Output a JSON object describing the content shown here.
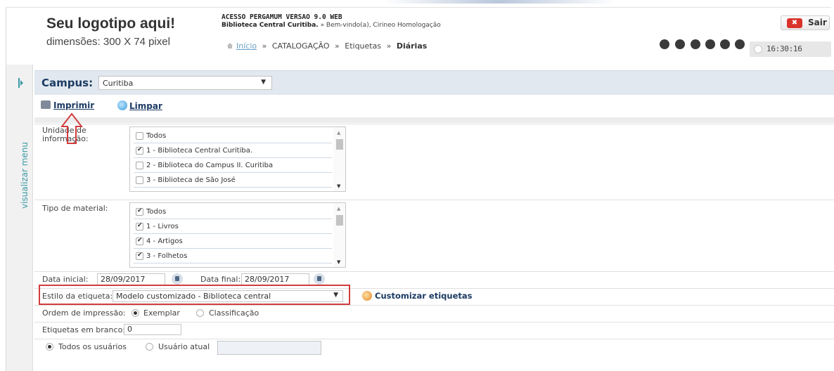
{
  "header": {
    "logo_title": "Seu logotipo aqui!",
    "logo_sub": "dimensões: 300 X 74 pixel",
    "app_title": "ACESSO PERGAMUM VERSAO 9.0 WEB",
    "library": "Biblioteca Central Curitiba.",
    "welcome": " » Bem-vindo(a), Cirineo Homologação",
    "logout_label": "Sair",
    "time": "16:30:16"
  },
  "breadcrumb": {
    "home": "Início",
    "items": [
      "CATALOGAÇÃO",
      "Etiquetas"
    ],
    "current": "Diárias",
    "separator": "»"
  },
  "toolbar_icons": [
    "help-icon",
    "refresh-icon",
    "accessibility-icon",
    "contrast-icon",
    "question-icon",
    "font-icon"
  ],
  "sidebar": {
    "label": "visualizar menu"
  },
  "campus": {
    "label": "Campus:",
    "selected": "Curitiba"
  },
  "actions": {
    "print": "Imprimir",
    "clear": "Limpar"
  },
  "unidade": {
    "label": "Unidade de informação:",
    "items": [
      {
        "label": "Todos",
        "checked": false
      },
      {
        "label": "1 - Biblioteca Central Curitiba.",
        "checked": true
      },
      {
        "label": "2 - Biblioteca do Campus II. Curitiba",
        "checked": false
      },
      {
        "label": "3 - Biblioteca de São José",
        "checked": false
      }
    ]
  },
  "tipo": {
    "label": "Tipo de material:",
    "items": [
      {
        "label": "Todos",
        "checked": true
      },
      {
        "label": "1 - Livros",
        "checked": true
      },
      {
        "label": "4 - Artigos",
        "checked": true
      },
      {
        "label": "3 - Folhetos",
        "checked": true
      }
    ]
  },
  "datas": {
    "inicial_label": "Data inicial:",
    "inicial_value": "28/09/2017",
    "final_label": "Data final:",
    "final_value": "28/09/2017"
  },
  "estilo": {
    "label": "Estilo da etiqueta:",
    "selected": "Modelo customizado - Biblioteca central",
    "customize": "Customizar etiquetas"
  },
  "ordem": {
    "label": "Ordem de impressão:",
    "options": [
      {
        "label": "Exemplar",
        "selected": true
      },
      {
        "label": "Classificação",
        "selected": false
      }
    ]
  },
  "branco": {
    "label": "Etiquetas em branco:",
    "value": "0"
  },
  "usuarios": {
    "options": [
      {
        "label": "Todos os usuários",
        "selected": true
      },
      {
        "label": "Usuário atual",
        "selected": false
      }
    ],
    "field_value": ""
  },
  "colors": {
    "accent": "#1c3b63",
    "highlight_border": "#d23c3c",
    "link": "#6aa0c8",
    "sidebar_text": "#3a9aa6"
  }
}
